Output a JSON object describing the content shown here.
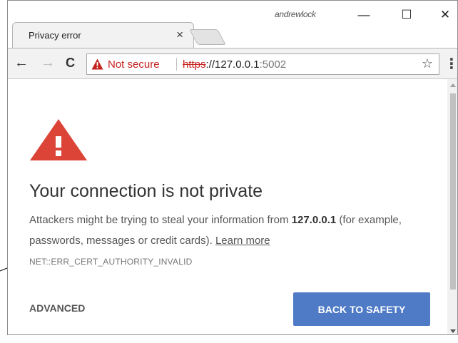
{
  "tab": {
    "title": "Privacy error",
    "close_glyph": "×"
  },
  "window": {
    "user": "andrewlock",
    "minimize": "—",
    "maximize": "☐",
    "close": "✕"
  },
  "toolbar": {
    "back": "←",
    "forward": "→",
    "reload": "C",
    "security_label": "Not secure",
    "url_scheme": "https",
    "url_rest_host": "://127.0.0.1",
    "url_port": ":5002",
    "bookmark_star": "☆",
    "menu": "⋮"
  },
  "page": {
    "heading": "Your connection is not private",
    "desc_part1": "Attackers might be trying to steal your information from ",
    "desc_host": "127.0.0.1",
    "desc_part2": " (for example, passwords, messages or credit cards). ",
    "learn_more": "Learn more",
    "error_code": "NET::ERR_CERT_AUTHORITY_INVALID",
    "advanced": "ADVANCED",
    "back_to_safety": "BACK TO SAFETY"
  },
  "colors": {
    "warning_red": "#db4437",
    "not_secure_red": "#c5221f",
    "button_blue": "#4e7ac6"
  },
  "icons": [
    "warning-triangle-icon",
    "star-icon",
    "menu-icon",
    "back-arrow-icon",
    "forward-arrow-icon",
    "reload-icon",
    "close-icon"
  ]
}
